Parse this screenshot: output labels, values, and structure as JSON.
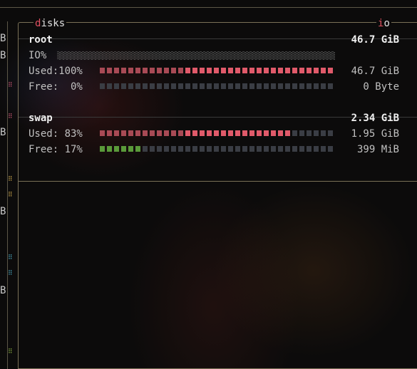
{
  "left_panel": {
    "labels": [
      "B",
      "B",
      "B",
      "B",
      "B"
    ],
    "mini_glyph": "⠿",
    "mini_colors": [
      "#d05a78",
      "#d05a78",
      "#d8b050",
      "#d8b050",
      "#4aa8c0",
      "#4aa8c0",
      "#8ab040"
    ]
  },
  "disks_panel": {
    "title_first": "d",
    "title_rest": "isks",
    "io_title_first": "i",
    "io_title_rest": "o",
    "root": {
      "name": "root",
      "total": "46.7 GiB",
      "io_label": "IO%",
      "used_label": "Used:100%",
      "used_value": "46.7 GiB",
      "used_fraction": 1.0,
      "free_label": "Free:  0%",
      "free_value": "0 Byte",
      "free_fraction": 0.0
    },
    "swap": {
      "name": "swap",
      "total": "2.34 GiB",
      "used_label": "Used: 83%",
      "used_value": "1.95 GiB",
      "used_fraction": 0.83,
      "free_label": "Free: 17%",
      "free_value": "399 MiB",
      "free_fraction": 0.17
    },
    "colors": {
      "used_bar": "#e05a6a",
      "used_bar_dim": "#a84a55",
      "free_bar": "#5a9a3a",
      "empty_bar": "#3a3d44",
      "accent": "#e05060"
    }
  }
}
